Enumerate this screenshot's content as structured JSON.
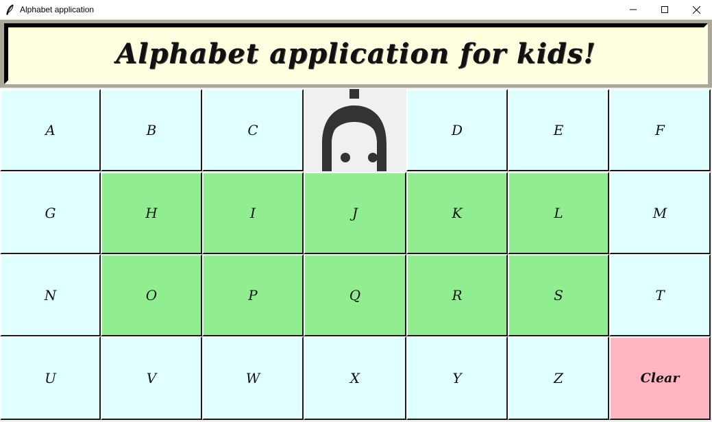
{
  "window": {
    "title": "Alphabet application",
    "icon": "feather-icon",
    "controls": [
      "minimize-icon",
      "maximize-icon",
      "close-icon"
    ]
  },
  "header": {
    "title": "Alphabet application for kids!"
  },
  "picture": {
    "icon": "cartoon-face-icon"
  },
  "buttons": {
    "A": "A",
    "B": "B",
    "C": "C",
    "D": "D",
    "E": "E",
    "F": "F",
    "G": "G",
    "H": "H",
    "I": "I",
    "J": "J",
    "K": "K",
    "L": "L",
    "M": "M",
    "N": "N",
    "O": "O",
    "P": "P",
    "Q": "Q",
    "R": "R",
    "S": "S",
    "T": "T",
    "U": "U",
    "V": "V",
    "W": "W",
    "X": "X",
    "Y": "Y",
    "Z": "Z",
    "clear": "Clear"
  },
  "colors": {
    "header_bg": "#ffffe0",
    "letter_bg": "#e0ffff",
    "highlight_bg": "#90ee90",
    "clear_bg": "#ffb6c1"
  }
}
